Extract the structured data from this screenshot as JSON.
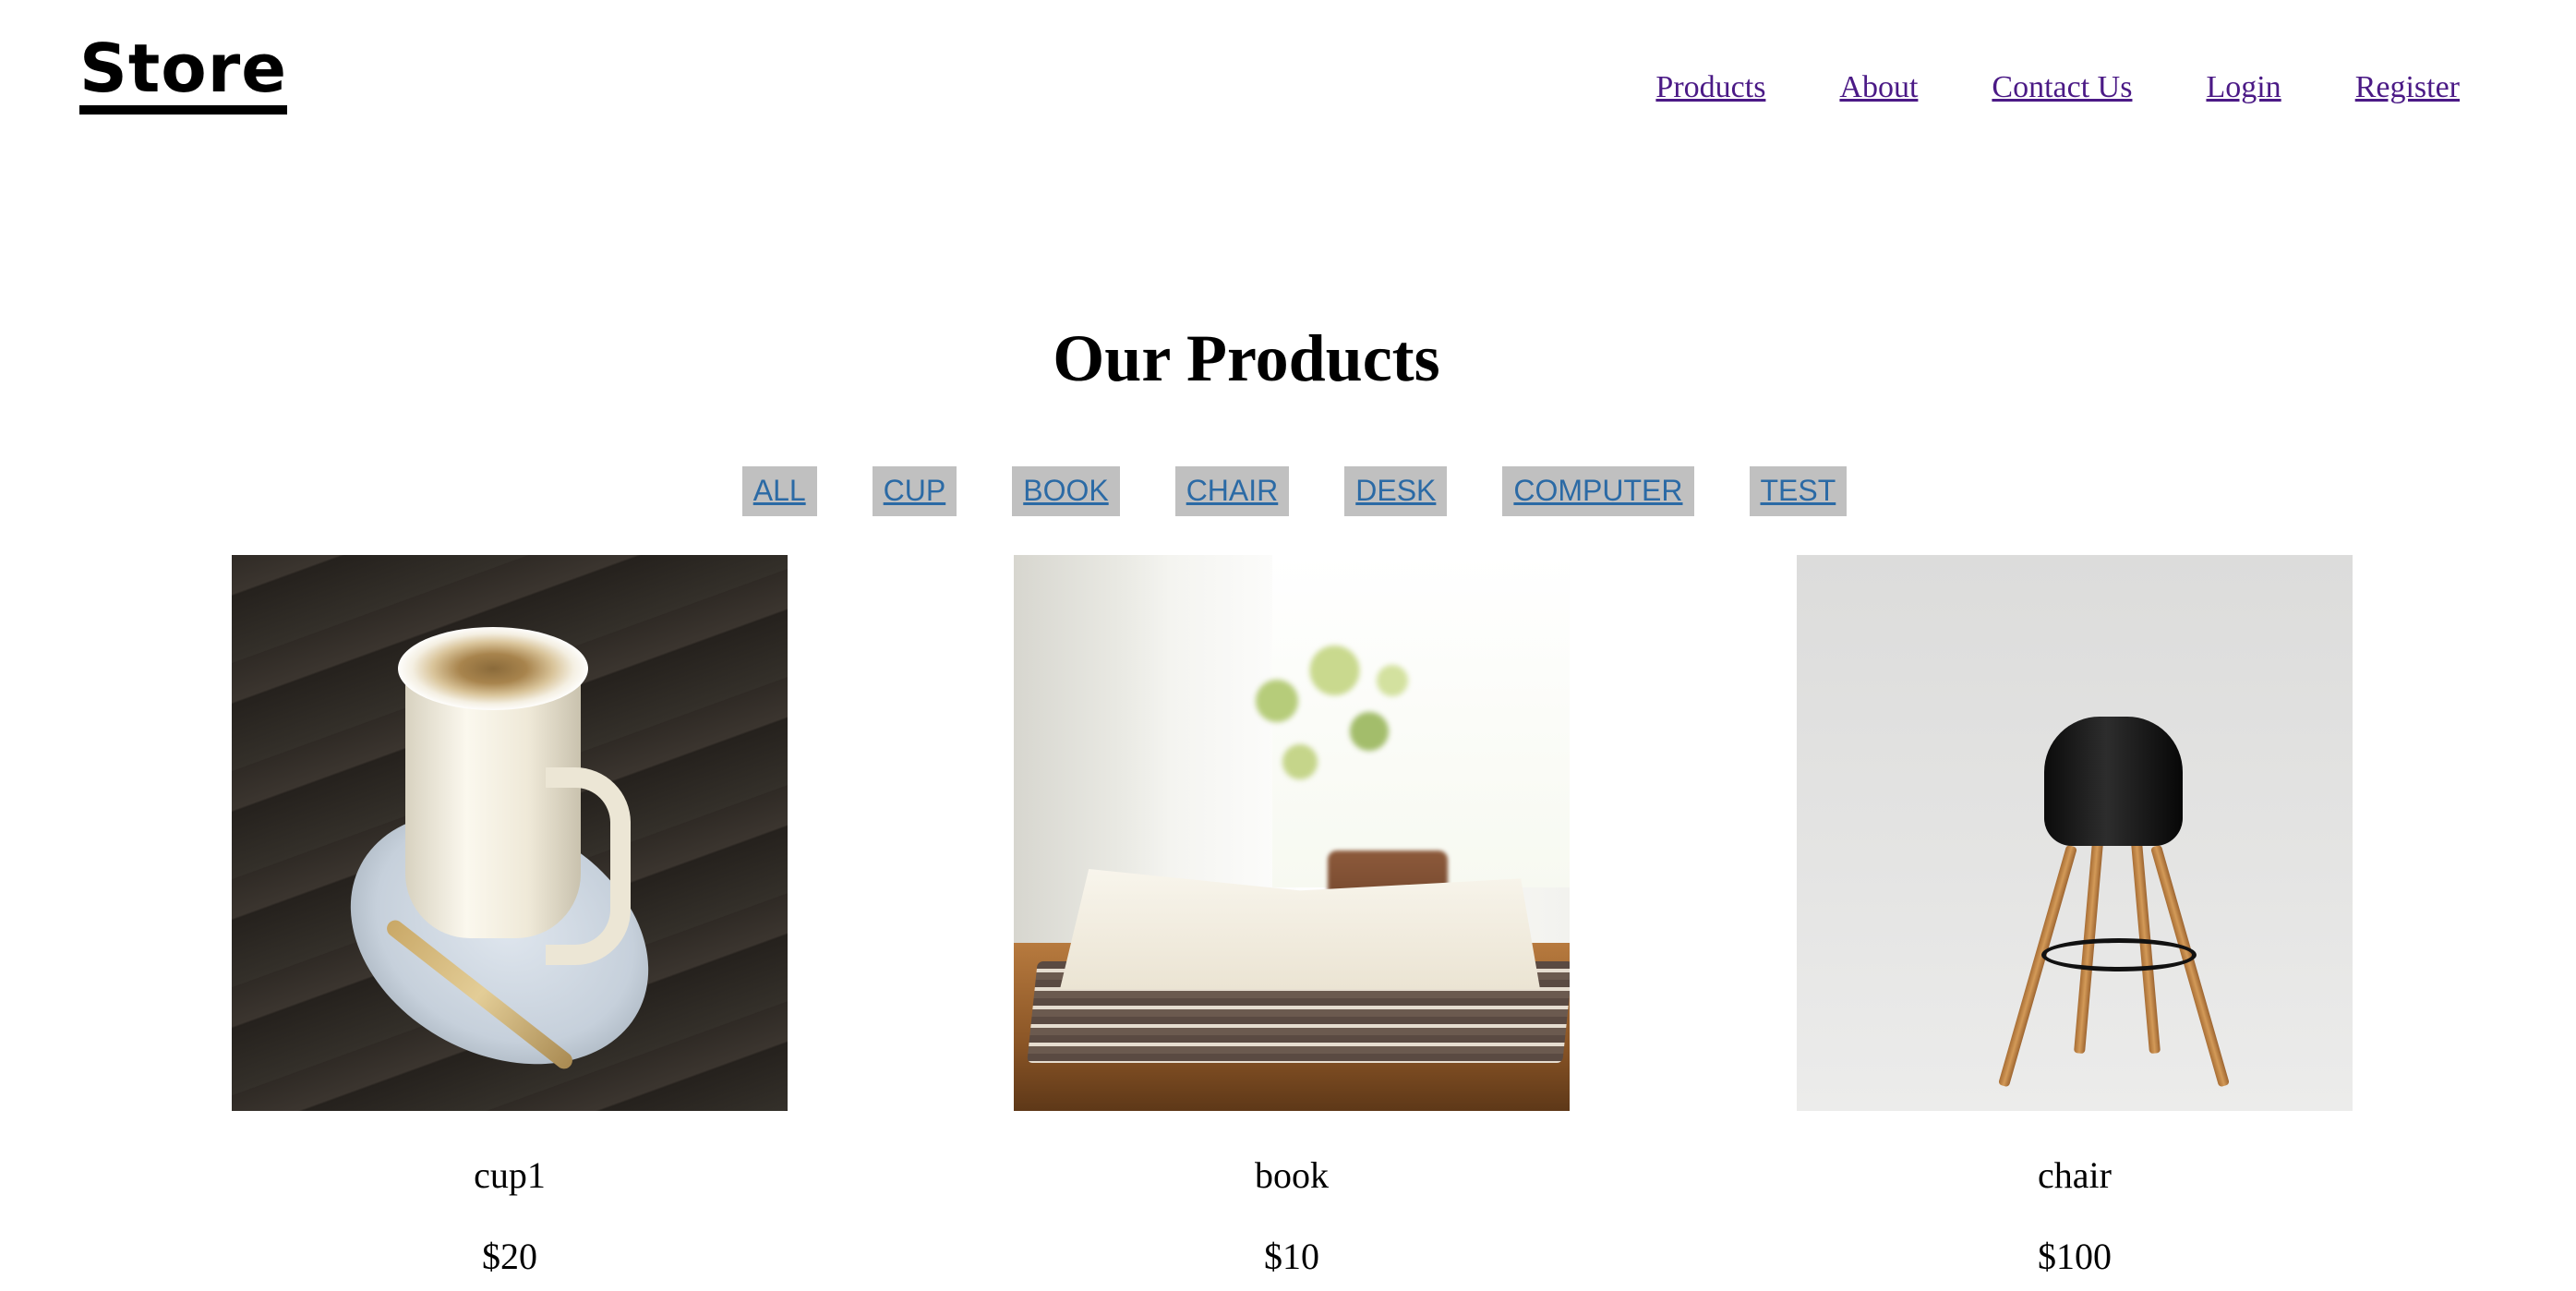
{
  "header": {
    "logo": "Store",
    "nav": [
      {
        "label": "Products"
      },
      {
        "label": "About"
      },
      {
        "label": "Contact Us"
      },
      {
        "label": "Login"
      },
      {
        "label": "Register"
      }
    ]
  },
  "main": {
    "title": "Our Products",
    "filters": [
      {
        "label": "ALL"
      },
      {
        "label": "CUP"
      },
      {
        "label": "BOOK"
      },
      {
        "label": "CHAIR"
      },
      {
        "label": "DESK"
      },
      {
        "label": "COMPUTER"
      },
      {
        "label": "TEST"
      }
    ],
    "products": [
      {
        "name": "cup1",
        "price": "$20"
      },
      {
        "name": "book",
        "price": "$10"
      },
      {
        "name": "chair",
        "price": "$100"
      }
    ]
  },
  "colors": {
    "nav_link": "#4b1a86",
    "filter_link": "#2b6aa5",
    "filter_bg": "#c0c0c0"
  }
}
